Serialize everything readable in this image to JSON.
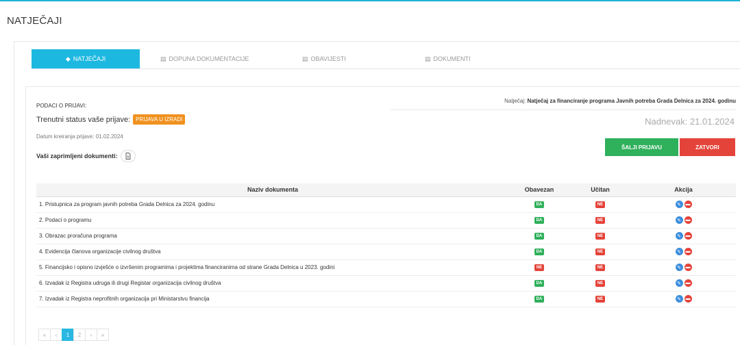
{
  "page": {
    "title": "NATJEČAJI"
  },
  "tabs": [
    {
      "label": "NATJEČAJI",
      "icon": "tag-icon",
      "active": true
    },
    {
      "label": "DOPUNA DOKUMENTACIJE",
      "icon": "list-icon",
      "active": false
    },
    {
      "label": "OBAVIJESTI",
      "icon": "list-icon",
      "active": false
    },
    {
      "label": "DOKUMENTI",
      "icon": "list-icon",
      "active": false
    }
  ],
  "info": {
    "heading": "PODACI O PRIJAVI:",
    "status_label": "Trenutni status vaše prijave:",
    "status_value": "PRIJAVA U IZRADI",
    "date_label": "Datum kreiranja prijave: 01.02.2024",
    "docs_label": "Vaši zaprimljeni dokumenti:"
  },
  "natjecaj": {
    "prefix": "Natječaj:",
    "name": "Natječaj za financiranje programa Javnih potreba Grada Delnica za 2024. godinu",
    "nadnevak": "Nadnevak: 21.01.2024"
  },
  "buttons": {
    "send": "ŠALJI PRIJAVU",
    "close": "ZATVORI"
  },
  "table": {
    "headers": [
      "Naziv dokumenta",
      "Obavezan",
      "Učitan",
      "Akcija"
    ],
    "rows": [
      {
        "name": "1. Pristupnica za program javnih potreba Grada Delnica za 2024. godinu",
        "obavezan": "DA",
        "ucitan": "NE"
      },
      {
        "name": "2. Podaci o programu",
        "obavezan": "DA",
        "ucitan": "NE"
      },
      {
        "name": "3. Obrazac proračuna programa",
        "obavezan": "DA",
        "ucitan": "NE"
      },
      {
        "name": "4. Evidencija članova organizacije civilnog društva",
        "obavezan": "DA",
        "ucitan": "NE"
      },
      {
        "name": "5. Financijsko i opisno izvješće o izvršenim programima i projektima financiranima od strane Grada Delnica u 2023. godini",
        "obavezan": "NE",
        "ucitan": "NE"
      },
      {
        "name": "6. Izvadak iz Registra udruga ili drugi Registar organizacija civilnog društva",
        "obavezan": "DA",
        "ucitan": "NE"
      },
      {
        "name": "7. Izvadak iz Registra neprofitnih organizacija pri Ministarstvu financija",
        "obavezan": "DA",
        "ucitan": "NE"
      }
    ]
  },
  "pagination": {
    "first": "«",
    "prev": "‹",
    "pages": [
      "1",
      "2"
    ],
    "current": "1",
    "next": "›",
    "last": "»"
  },
  "colors": {
    "accent": "#1cb8e0",
    "success": "#2fb05b",
    "danger": "#e4433a",
    "warning": "#f0911f",
    "edit": "#3c8ddc"
  }
}
